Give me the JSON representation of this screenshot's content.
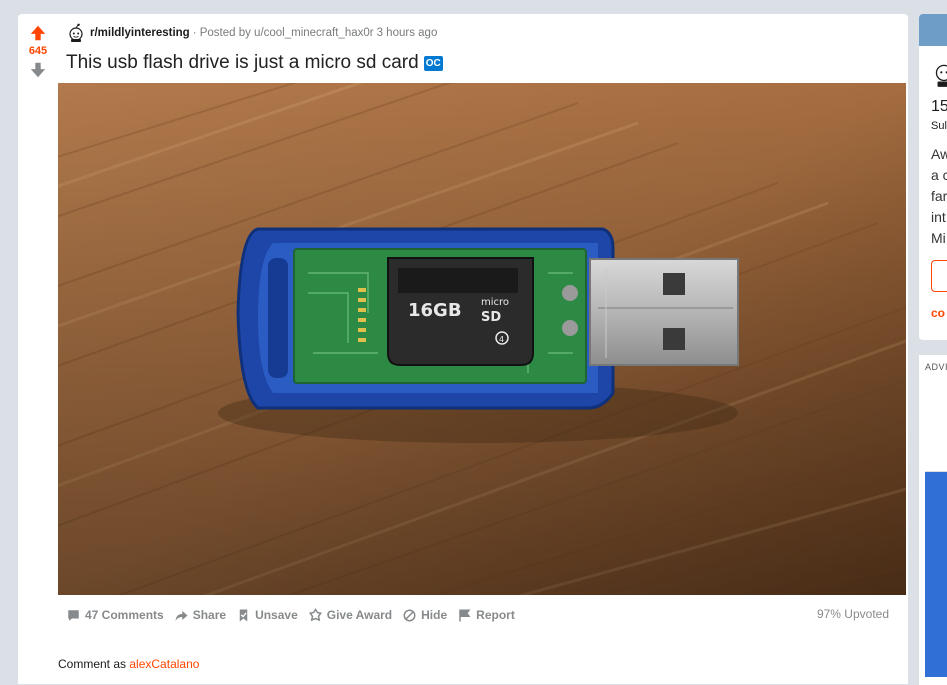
{
  "post": {
    "score": "645",
    "subreddit": "r/mildlyinteresting",
    "posted_by": "· Posted by u/cool_minecraft_hax0r",
    "time_ago": "3 hours ago",
    "title": "This usb flash drive is just a micro sd card",
    "flair": "OC",
    "image": {
      "description_icon": "usb-drive-photo",
      "card_capacity": "16GB",
      "card_brand_line1": "micro",
      "card_brand_line2": "SD",
      "card_class": "4"
    }
  },
  "actions": {
    "comments": "47 Comments",
    "share": "Share",
    "unsave": "Unsave",
    "give_award": "Give Award",
    "hide": "Hide",
    "report": "Report",
    "upvoted": "97% Upvoted"
  },
  "comment_box": {
    "prefix": "Comment as",
    "username": "alexCatalano"
  },
  "sidebar": {
    "members_fragment": "15",
    "sub_fragment": "Sul",
    "desc_lines": [
      "Aw",
      "a c",
      "far",
      "int",
      "Mi"
    ],
    "link_fragment": "co"
  },
  "ad": {
    "label": "ADVI"
  },
  "colors": {
    "upvote": "#ff4500",
    "oc_badge": "#0079d3",
    "background": "#dae0e6",
    "sidebar_header": "#6e9dc8",
    "ad_blue": "#2f6fd6"
  }
}
